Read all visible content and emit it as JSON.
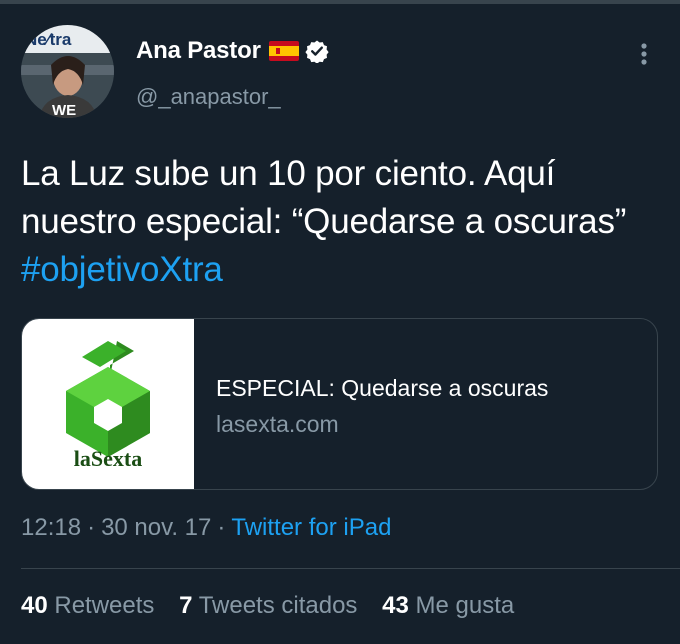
{
  "author": {
    "name": "Ana Pastor",
    "handle": "@_anapastor_",
    "avatar_shirt_text": "WE",
    "avatar_logo_text": "Ne∕tra"
  },
  "tweet": {
    "text_main": "La Luz sube un 10 por ciento. Aquí nuestro especial: “Quedarse a oscuras”",
    "hashtag": "#objetivoXtra"
  },
  "link_card": {
    "logo_text": "laSexta",
    "title": "ESPECIAL: Quedarse a oscuras",
    "domain": "lasexta.com"
  },
  "meta": {
    "time": "12:18",
    "date": "30 nov. 17",
    "separator": "·",
    "source": "Twitter for iPad"
  },
  "stats": {
    "retweets_count": "40",
    "retweets_label": "Retweets",
    "quotes_count": "7",
    "quotes_label": "Tweets citados",
    "likes_count": "43",
    "likes_label": "Me gusta"
  },
  "colors": {
    "background": "#15202b",
    "text": "#ffffff",
    "secondary": "#8899a6",
    "link": "#1da1f2",
    "border": "#38444d",
    "logo_green": "#3bb12a"
  },
  "icons": {
    "flag": "spain-flag-icon",
    "verified": "verified-badge-icon",
    "more": "more-options-icon"
  }
}
